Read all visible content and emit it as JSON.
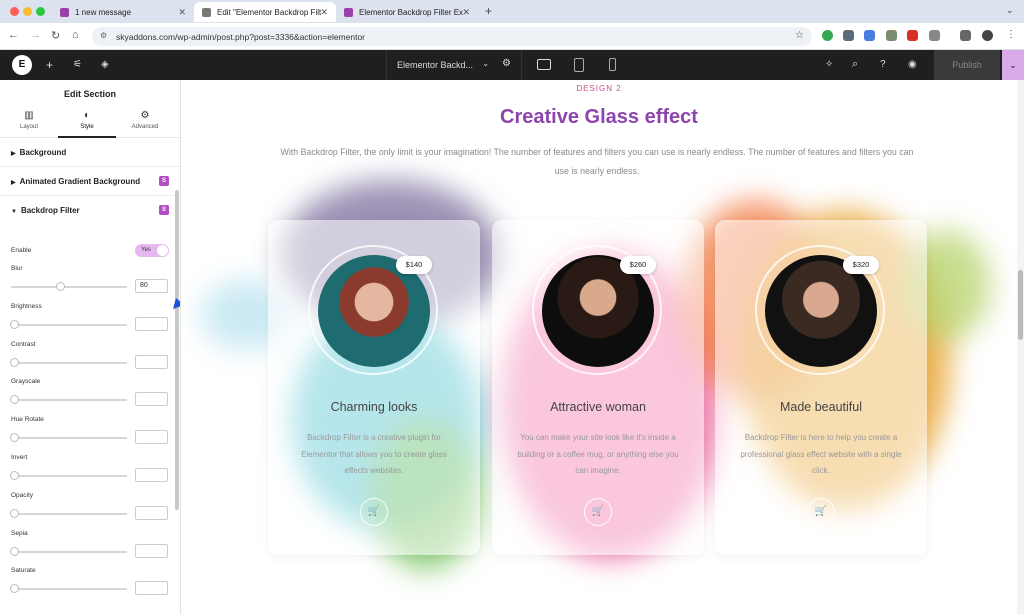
{
  "browser": {
    "tabs": [
      {
        "title": "1 new message",
        "active": false
      },
      {
        "title": "Edit \"Elementor Backdrop Filt",
        "active": true
      },
      {
        "title": "Elementor Backdrop Filter Ex",
        "active": false
      }
    ],
    "url": "skyaddons.com/wp-admin/post.php?post=3336&action=elementor"
  },
  "editor": {
    "page_title": "Elementor Backd...",
    "publish_label": "Publish"
  },
  "panel": {
    "title": "Edit Section",
    "tabs": [
      "Layout",
      "Style",
      "Advanced"
    ],
    "active_tab": "Style",
    "sections": [
      "Background",
      "Animated Gradient Background",
      "Backdrop Filter"
    ],
    "enable_label": "Enable",
    "enable_value": "Yes",
    "controls": [
      {
        "label": "Blur",
        "value": "80",
        "fraction": 0.4
      },
      {
        "label": "Brightness",
        "value": "",
        "fraction": 0
      },
      {
        "label": "Contrast",
        "value": "",
        "fraction": 0
      },
      {
        "label": "Grayscale",
        "value": "",
        "fraction": 0
      },
      {
        "label": "Hue Rotate",
        "value": "",
        "fraction": 0
      },
      {
        "label": "Invert",
        "value": "",
        "fraction": 0
      },
      {
        "label": "Opacity",
        "value": "",
        "fraction": 0
      },
      {
        "label": "Sepia",
        "value": "",
        "fraction": 0
      },
      {
        "label": "Saturate",
        "value": "",
        "fraction": 0
      }
    ]
  },
  "canvas": {
    "eyebrow": "DESIGN 2",
    "headline": "Creative Glass effect",
    "description": "With Backdrop Filter, the only limit is your imagination! The number of features and filters you can use is nearly endless. The number of features and filters you can use is nearly endless.",
    "cards": [
      {
        "price": "$140",
        "title": "Charming looks",
        "text": "Backdrop Filter is a creative plugin for Elementor that allows you to create glass effects websites."
      },
      {
        "price": "$260",
        "title": "Attractive woman",
        "text": "You can make your site look like it's inside a building or a coffee mug, or anything else you can imagine."
      },
      {
        "price": "$320",
        "title": "Made beautiful",
        "text": "Backdrop Filter is here to help you create a professional glass effect website with a single click."
      }
    ]
  },
  "colors": {
    "accent": "#8e44ad",
    "eyebrow": "#c24f8a",
    "pro_badge": "#b04fbf"
  }
}
